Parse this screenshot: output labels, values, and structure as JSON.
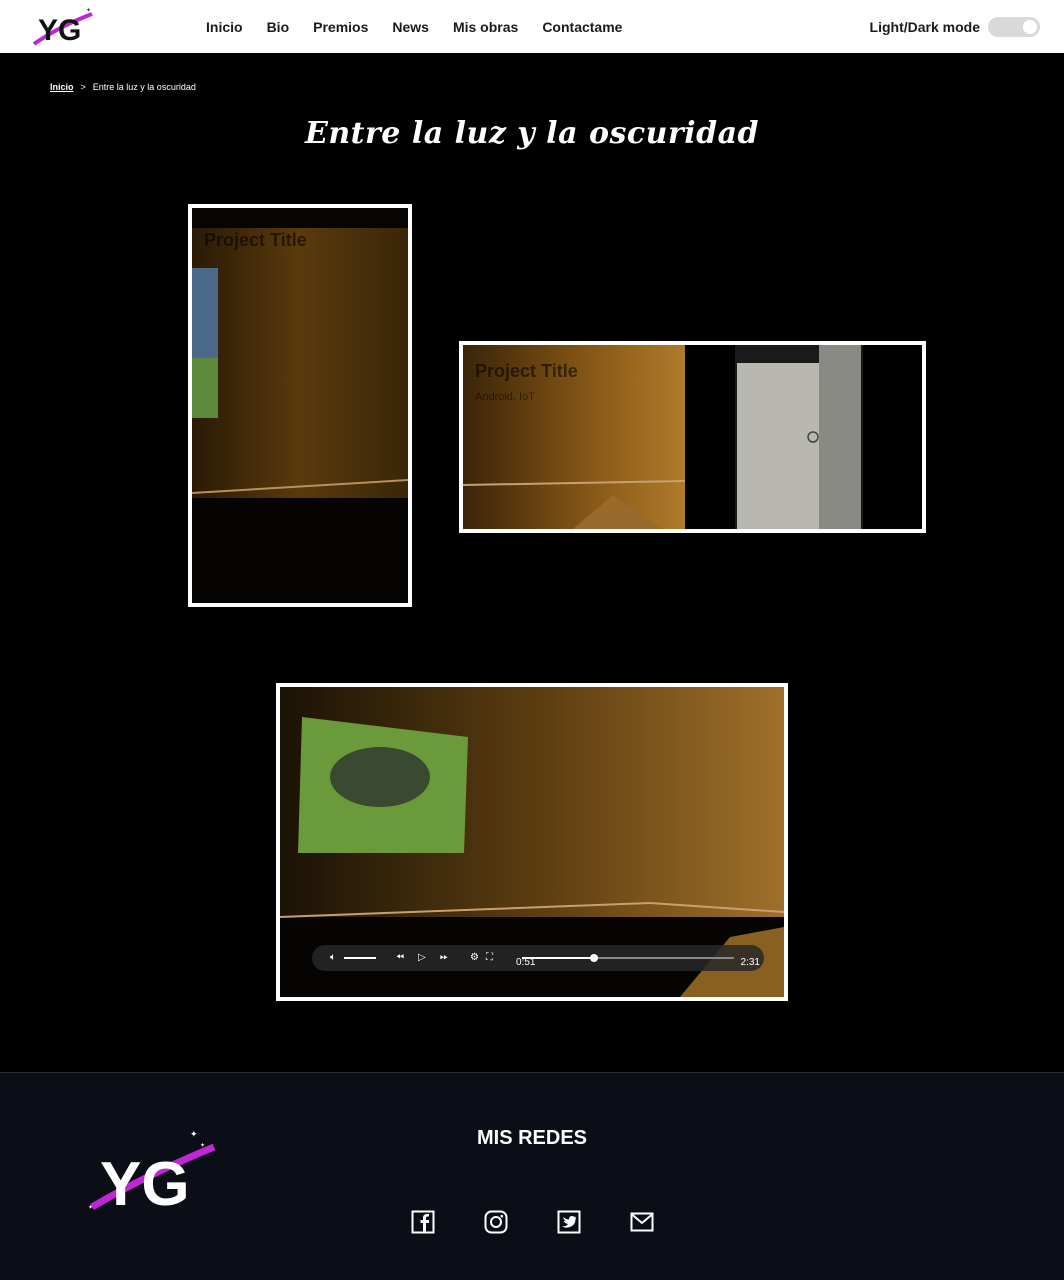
{
  "header": {
    "logo_text": "YG",
    "nav": [
      "Inicio",
      "Bio",
      "Premios",
      "News",
      "Mis obras",
      "Contactame"
    ],
    "mode_label": "Light/Dark mode"
  },
  "breadcrumb": {
    "home": "Inicio",
    "separator": ">",
    "current": "Entre la luz y la oscuridad"
  },
  "page_title": "Entre la luz y la oscuridad",
  "cards": [
    {
      "title": "Project Title",
      "subtitle": ""
    },
    {
      "title": "Project Title",
      "subtitle": "Android, IoT"
    }
  ],
  "video": {
    "current_time": "0:51",
    "duration": "2:31",
    "progress_fraction": 0.34,
    "volume_fraction": 0.75,
    "icons": [
      "volume-icon",
      "rewind-icon",
      "play-icon",
      "fast-forward-icon",
      "settings-icon",
      "fullscreen-icon"
    ]
  },
  "footer": {
    "logo_text": "YG",
    "title": "MIS REDES",
    "socials": [
      "facebook-icon",
      "instagram-icon",
      "twitter-icon",
      "mail-icon"
    ]
  },
  "colors": {
    "background": "#000000",
    "header_bg": "#ffffff",
    "footer_bg": "#0b0e16",
    "logo_accent": "#c026d3"
  }
}
